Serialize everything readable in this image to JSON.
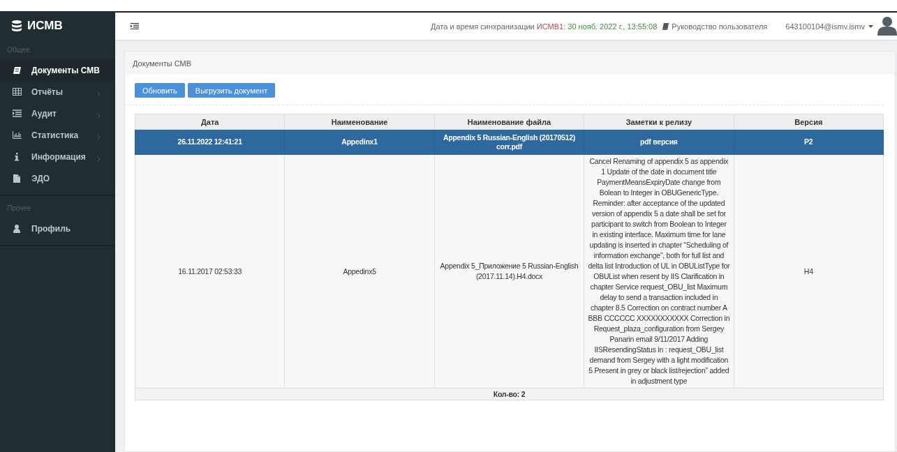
{
  "sidebar": {
    "logo": "ИСМВ",
    "sections": [
      {
        "label": "Общее",
        "items": [
          {
            "label": "Документы СМВ",
            "selected": true,
            "expandable": false
          },
          {
            "label": "Отчёты",
            "selected": false,
            "expandable": true
          },
          {
            "label": "Аудит",
            "selected": false,
            "expandable": true
          },
          {
            "label": "Статистика",
            "selected": false,
            "expandable": true
          },
          {
            "label": "Информация",
            "selected": false,
            "expandable": true
          },
          {
            "label": "ЭДО",
            "selected": false,
            "expandable": false
          }
        ]
      },
      {
        "label": "Прочее",
        "items": [
          {
            "label": "Профиль",
            "selected": false,
            "expandable": false
          }
        ]
      }
    ]
  },
  "header": {
    "sync_label": "Дата и время синхранизации",
    "sync_system": "ИСМВ1:",
    "sync_time": "30 нояб. 2022 г., 13:55:08",
    "guide_link": "Руководство пользователя",
    "user": "643100104@ismv.ismv"
  },
  "panel": {
    "title": "Документы СМВ",
    "buttons": [
      "Обновить",
      "Выгрузить документ"
    ],
    "table": {
      "columns": [
        "Дата",
        "Наименование",
        "Наименование файла",
        "Заметки к релизу",
        "Версия"
      ],
      "rows": [
        {
          "selected": true,
          "cells": [
            "26.11.2022 12:41:21",
            "Appedinx1",
            "Appendix 5 Russian-English (20170512) corr.pdf",
            "pdf версия",
            "P2"
          ]
        },
        {
          "selected": false,
          "cells": [
            "16.11.2017 02:53:33",
            "Appedinx5",
            "Appendix 5_Приложение 5 Russian-English (2017.11.14).H4.docx",
            "Cancel Renaming of appendix 5 as appendix 1 Update of the date in document title PaymentMeansExpiryDate change from Bolean to Integer in OBUGenericType. Reminder: after acceptance of the updated version of appendix 5 a date shall be set for participant to switch from Boolean to Integer in existing interface. Maximum time for lane updating is inserted in chapter “Scheduling of information exchange”, both for full list and delta list Introduction of UL in OBUListType for OBUList when resent by IIS Clarification in chapter Service request_OBU_list Maximum delay to send a transaction included in chapter 8.5 Correction on contract number A BBB CCCCCC XXXXXXXXXXX Correction in Request_plaza_configuration from Sergey Panarin email 9/11/2017 Adding IISResendingStatus in : request_OBU_list demand from Sergey with a light modification 5 Present in grey or black list/rejection” added in adjustment type",
            "H4"
          ]
        }
      ],
      "footer": "Кол-во: 2"
    }
  }
}
